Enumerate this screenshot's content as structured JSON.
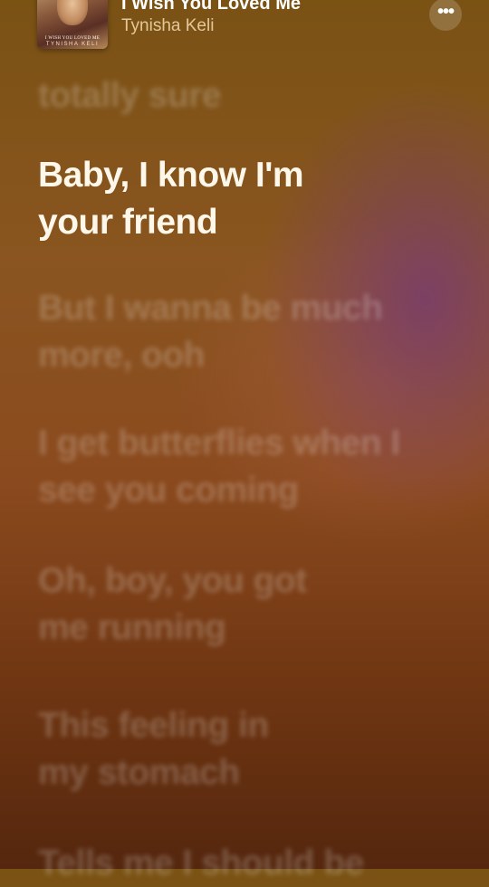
{
  "now_playing": {
    "title": "I Wish You Loved Me",
    "artist": "Tynisha Keli",
    "album_art_caption": "I WISH YOU LOVED ME",
    "album_art_artist": "TYNISHA KELI"
  },
  "more_button": {
    "icon": "ellipsis-icon",
    "symbol": "•••"
  },
  "lyrics": {
    "previous": "totally sure",
    "current": "Baby, I know I'm your friend",
    "next_1": "But I wanna be much more, ooh",
    "next_2": "I get butterflies when I see you coming",
    "next_3": "Oh, boy, you got me running",
    "next_4": "This feeling in my stomach",
    "next_5": "Tells me I should be"
  }
}
